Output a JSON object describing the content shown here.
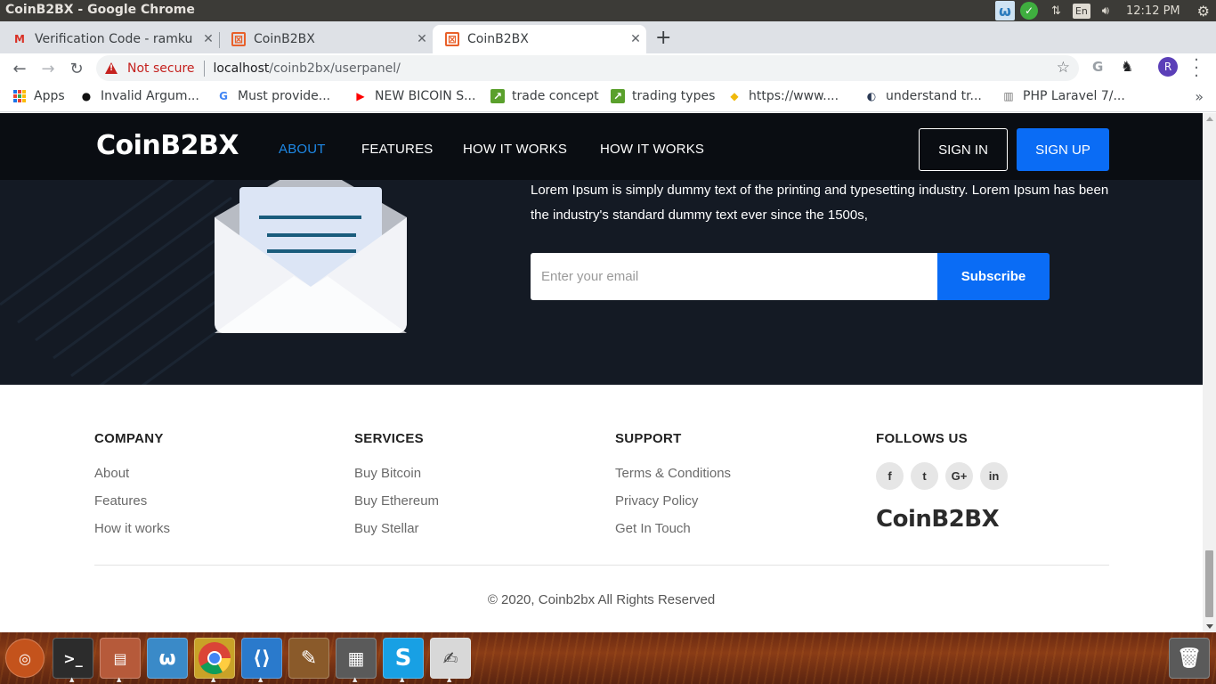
{
  "os": {
    "window_title": "CoinB2BX - Google Chrome",
    "clock": "12:12 PM",
    "keyboard": "En"
  },
  "tabs": [
    {
      "label": "Verification Code - ramku",
      "icon": "gmail-icon",
      "active": false
    },
    {
      "label": "CoinB2BX",
      "icon": "coinb2bx-favicon",
      "active": false
    },
    {
      "label": "CoinB2BX",
      "icon": "coinb2bx-favicon",
      "active": true
    }
  ],
  "toolbar": {
    "security_label": "Not secure",
    "url_host": "localhost",
    "url_path": "/coinb2bx/userpanel/",
    "avatar_initial": "R"
  },
  "bookmarks": [
    {
      "label": "Apps",
      "icon": "apps-grid-icon"
    },
    {
      "label": "Invalid Argum...",
      "icon": "github-icon"
    },
    {
      "label": "Must provide...",
      "icon": "google-icon"
    },
    {
      "label": "NEW BICOIN S...",
      "icon": "youtube-icon"
    },
    {
      "label": "trade concept",
      "icon": "chart-icon"
    },
    {
      "label": "trading types",
      "icon": "chart-icon"
    },
    {
      "label": "https://www....",
      "icon": "binance-icon"
    },
    {
      "label": "understand tr...",
      "icon": "site-icon"
    },
    {
      "label": "PHP Laravel 7/...",
      "icon": "laravel-icon"
    }
  ],
  "site": {
    "logo": "CoinB2BX",
    "nav": [
      "ABOUT",
      "FEATURES",
      "HOW IT WORKS",
      "HOW IT WORKS"
    ],
    "sign_in": "SIGN IN",
    "sign_up": "SIGN UP",
    "accent_color": "#0a6cf5"
  },
  "subscribe": {
    "text": "Lorem Ipsum is simply dummy text of the printing and typesetting industry. Lorem Ipsum has been the industry's standard dummy text ever since the 1500s,",
    "email_placeholder": "Enter your email",
    "button": "Subscribe"
  },
  "footer": {
    "columns": [
      {
        "title": "COMPANY",
        "links": [
          "About",
          "Features",
          "How it works"
        ]
      },
      {
        "title": "SERVICES",
        "links": [
          "Buy Bitcoin",
          "Buy Ethereum",
          "Buy Stellar"
        ]
      },
      {
        "title": "SUPPORT",
        "links": [
          "Terms & Conditions",
          "Privacy Policy",
          "Get In Touch"
        ]
      }
    ],
    "follow_title": "FOLLOWS US",
    "social": [
      {
        "icon": "facebook-icon",
        "glyph": "f"
      },
      {
        "icon": "twitter-icon",
        "glyph": "t"
      },
      {
        "icon": "google-plus-icon",
        "glyph": "G+"
      },
      {
        "icon": "linkedin-icon",
        "glyph": "in"
      }
    ],
    "logo": "CoinB2BX",
    "copyright": "© 2020, Coinb2bx All Rights Reserved"
  },
  "dock": [
    "ubuntu-icon",
    "terminal-icon",
    "files-icon",
    "webstorm-icon",
    "chrome-icon",
    "vscode-icon",
    "gimp-icon",
    "calculator-icon",
    "skype-icon",
    "text-editor-icon",
    "trash-icon"
  ]
}
